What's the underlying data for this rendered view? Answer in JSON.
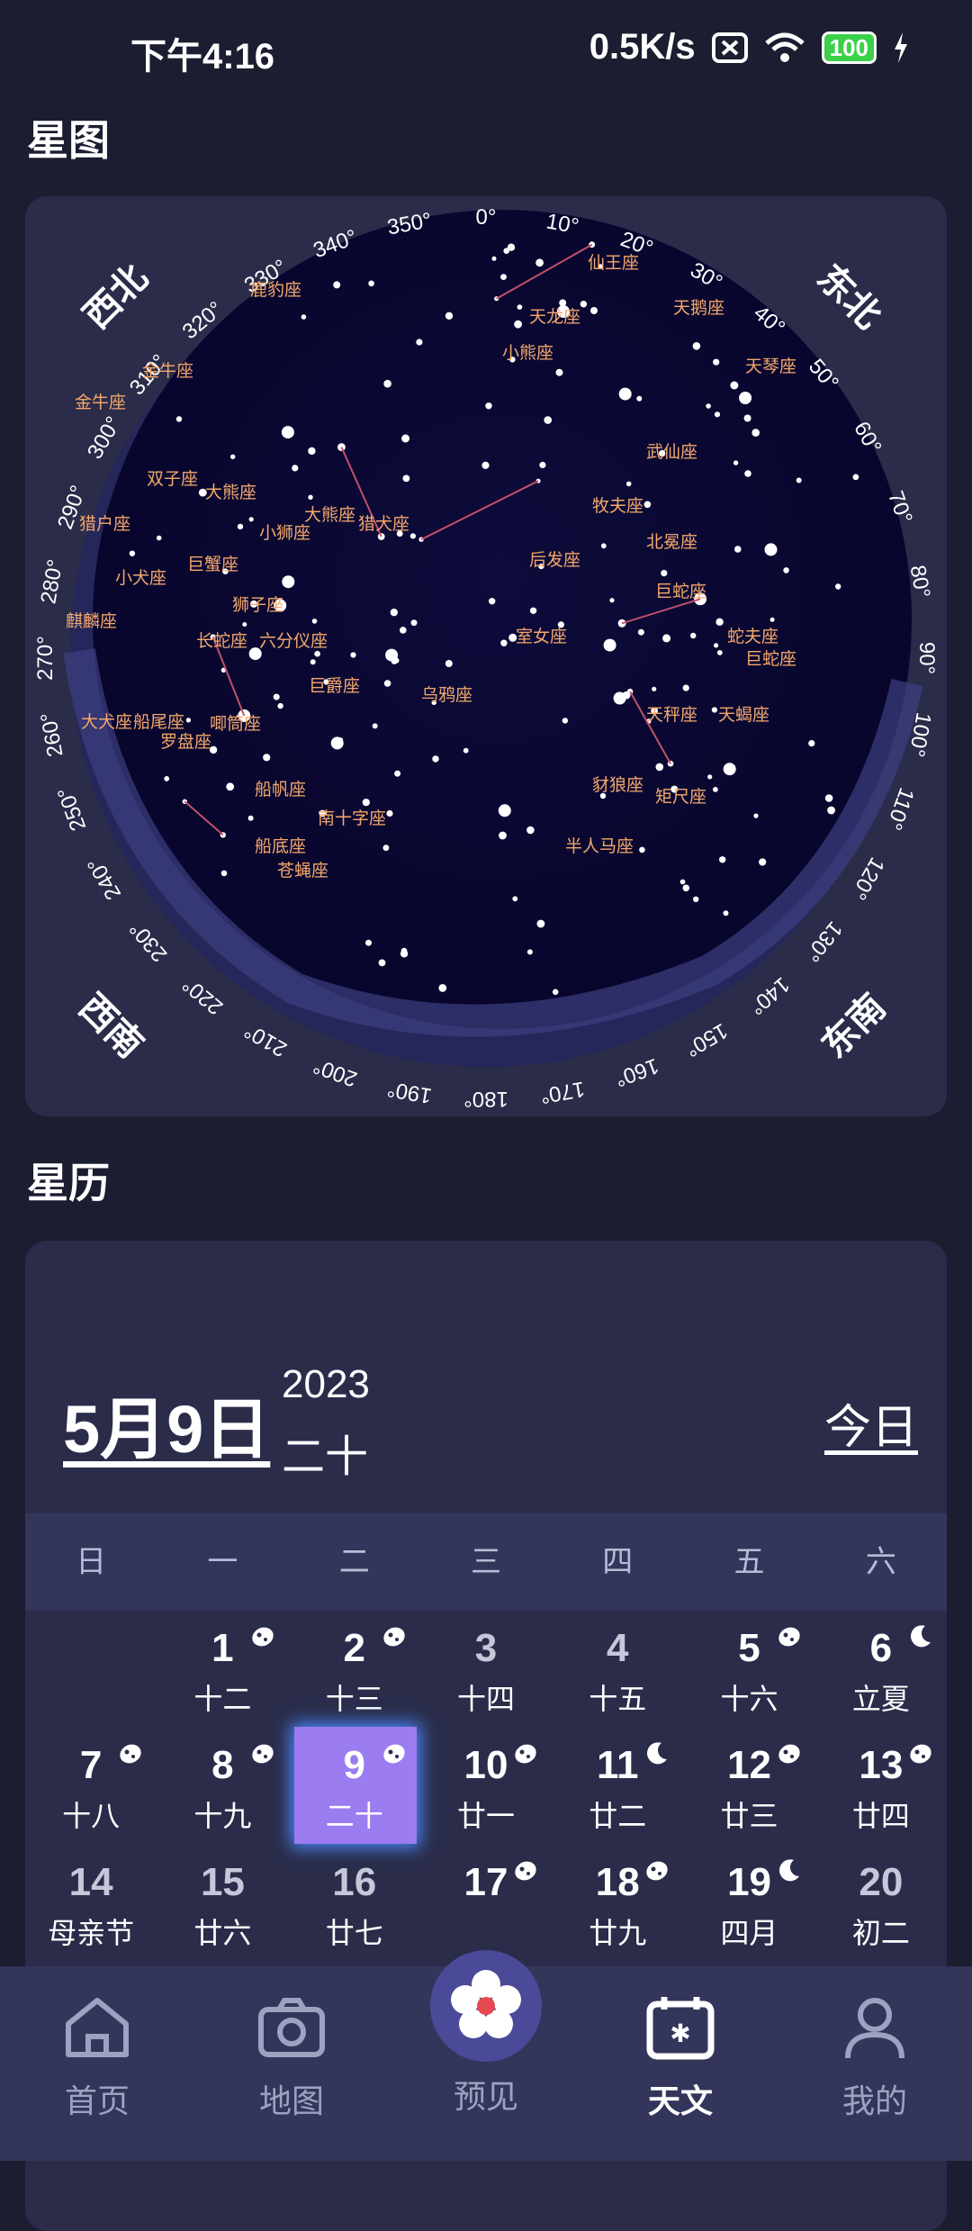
{
  "status": {
    "time": "下午4:16",
    "net": "0.5K/s",
    "battery": "100"
  },
  "starmap": {
    "title": "星图",
    "directions": {
      "nw": "西北",
      "ne": "东北",
      "sw": "西南",
      "se": "东南"
    },
    "degrees": [
      "350°",
      "0°",
      "10°",
      "20°",
      "30°",
      "40°",
      "50°",
      "60°",
      "70°",
      "80°",
      "90°",
      "100°",
      "110°",
      "120°",
      "130°",
      "140°",
      "150°",
      "160°",
      "170°",
      "180°",
      "190°",
      "200°",
      "210°",
      "220°",
      "230°",
      "240°",
      "250°",
      "260°",
      "270°",
      "280°",
      "290°",
      "300°",
      "310°",
      "320°",
      "330°",
      "340°"
    ],
    "constellations": [
      "仙王座",
      "鹿豹座",
      "天龙座",
      "天鹅座",
      "小熊座",
      "天琴座",
      "金牛座",
      "金牛座",
      "武仙座",
      "双子座",
      "大熊座",
      "牧夫座",
      "猎户座",
      "大熊座",
      "猎犬座",
      "小狮座",
      "北冕座",
      "小犬座",
      "巨蟹座",
      "后发座",
      "巨蛇座",
      "狮子座",
      "麒麟座",
      "长蛇座",
      "六分仪座",
      "室女座",
      "蛇夫座",
      "巨蛇座",
      "巨爵座",
      "乌鸦座",
      "大犬座",
      "船尾座",
      "天秤座",
      "天蝎座",
      "唧筒座",
      "罗盘座",
      "豺狼座",
      "矩尺座",
      "船帆座",
      "南十字座",
      "船底座",
      "半人马座",
      "苍蝇座"
    ]
  },
  "calendar": {
    "title": "星历",
    "date": "5月9日",
    "year": "2023",
    "lunar": "二十",
    "today": "今日",
    "weekdays": [
      "日",
      "一",
      "二",
      "三",
      "四",
      "五",
      "六"
    ],
    "rows": [
      [
        {
          "n": "",
          "l": ""
        },
        {
          "n": "1",
          "l": "十二",
          "m": "c"
        },
        {
          "n": "2",
          "l": "十三",
          "m": "c"
        },
        {
          "n": "3",
          "l": "十四",
          "d": 1
        },
        {
          "n": "4",
          "l": "十五",
          "d": 1
        },
        {
          "n": "5",
          "l": "十六",
          "m": "c"
        },
        {
          "n": "6",
          "l": "立夏",
          "m": "m"
        }
      ],
      [
        {
          "n": "7",
          "l": "十八",
          "m": "c"
        },
        {
          "n": "8",
          "l": "十九",
          "m": "c"
        },
        {
          "n": "9",
          "l": "二十",
          "m": "c",
          "s": 1
        },
        {
          "n": "10",
          "l": "廿一",
          "m": "c"
        },
        {
          "n": "11",
          "l": "廿二",
          "m": "m"
        },
        {
          "n": "12",
          "l": "廿三",
          "m": "c"
        },
        {
          "n": "13",
          "l": "廿四",
          "m": "c"
        }
      ],
      [
        {
          "n": "14",
          "l": "母亲节",
          "d": 1
        },
        {
          "n": "15",
          "l": "廿六",
          "d": 1
        },
        {
          "n": "16",
          "l": "廿七",
          "d": 1
        },
        {
          "n": "17",
          "l": "",
          "m": "c"
        },
        {
          "n": "18",
          "l": "廿九",
          "m": "c"
        },
        {
          "n": "19",
          "l": "四月",
          "m": "m"
        },
        {
          "n": "20",
          "l": "初二",
          "d": 1
        }
      ]
    ]
  },
  "nav": {
    "home": "首页",
    "map": "地图",
    "preview": "预见",
    "astro": "天文",
    "me": "我的"
  }
}
